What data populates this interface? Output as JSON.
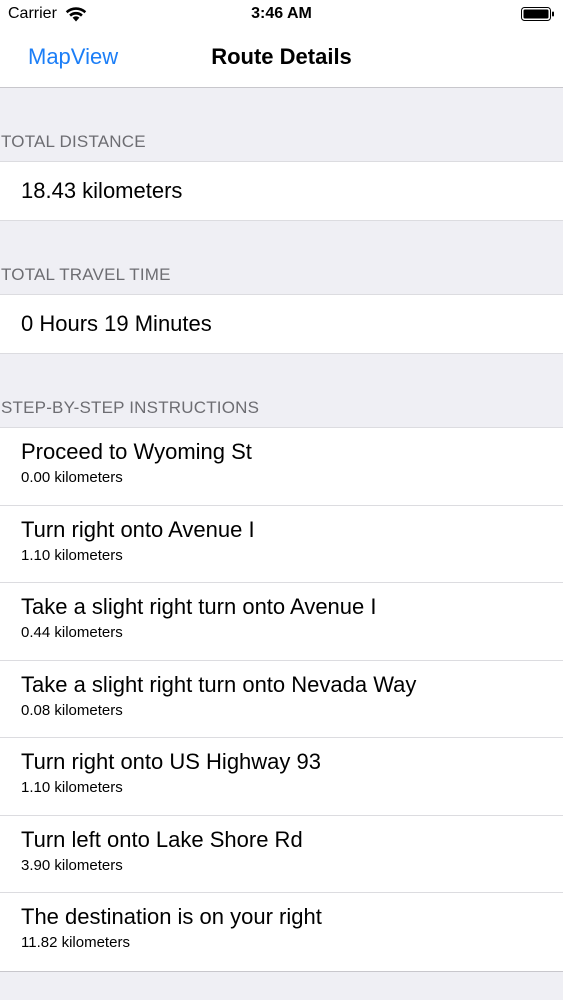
{
  "status_bar": {
    "carrier": "Carrier",
    "time": "3:46 AM",
    "wifi_icon": "wifi-icon",
    "battery_icon": "battery-icon"
  },
  "nav": {
    "back_label": "MapView",
    "title": "Route Details"
  },
  "sections": {
    "distance": {
      "header": "TOTAL DISTANCE",
      "value": "18.43 kilometers"
    },
    "time": {
      "header": "TOTAL TRAVEL TIME",
      "value": "0 Hours 19 Minutes"
    },
    "steps": {
      "header": "STEP-BY-STEP INSTRUCTIONS",
      "items": [
        {
          "instruction": "Proceed to Wyoming St",
          "distance": "0.00 kilometers"
        },
        {
          "instruction": "Turn right onto Avenue I",
          "distance": "1.10 kilometers"
        },
        {
          "instruction": "Take a slight right turn onto Avenue I",
          "distance": "0.44 kilometers"
        },
        {
          "instruction": "Take a slight right turn onto Nevada Way",
          "distance": "0.08 kilometers"
        },
        {
          "instruction": "Turn right onto US Highway 93",
          "distance": "1.10 kilometers"
        },
        {
          "instruction": "Turn left onto Lake Shore Rd",
          "distance": "3.90 kilometers"
        },
        {
          "instruction": "The destination is on your right",
          "distance": "11.82 kilometers"
        }
      ]
    }
  },
  "colors": {
    "accent": "#1b7ef7",
    "background": "#efeff4",
    "header_text": "#6d6d72"
  }
}
